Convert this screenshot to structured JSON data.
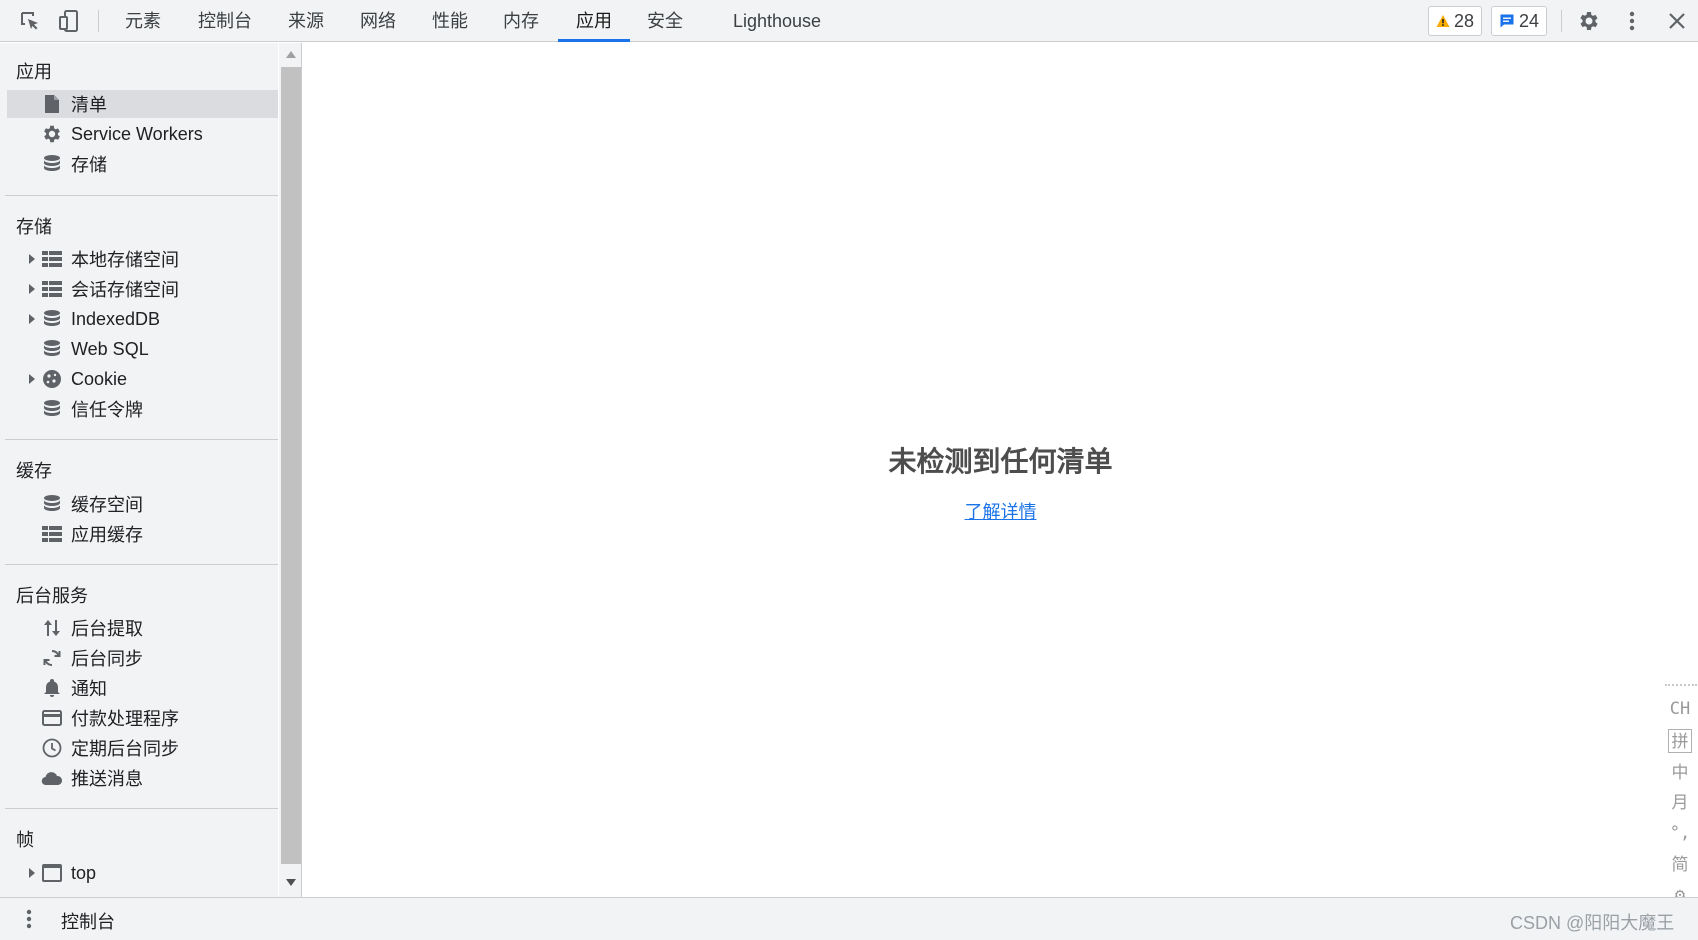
{
  "toolbar": {
    "tabs": [
      {
        "label": "元素"
      },
      {
        "label": "控制台"
      },
      {
        "label": "来源"
      },
      {
        "label": "网络"
      },
      {
        "label": "性能"
      },
      {
        "label": "内存"
      },
      {
        "label": "应用",
        "active": true
      },
      {
        "label": "安全"
      },
      {
        "label": "Lighthouse"
      }
    ],
    "warnings_count": "28",
    "messages_count": "24",
    "warning_color": "#f9ab00",
    "message_color": "#1a73e8"
  },
  "sidebar": {
    "sections": [
      {
        "title": "应用",
        "items": [
          {
            "label": "清单",
            "icon": "document-icon",
            "selected": true
          },
          {
            "label": "Service Workers",
            "icon": "gear-icon"
          },
          {
            "label": "存储",
            "icon": "database-icon"
          }
        ]
      },
      {
        "title": "存储",
        "items": [
          {
            "label": "本地存储空间",
            "icon": "table-icon",
            "expandable": true
          },
          {
            "label": "会话存储空间",
            "icon": "table-icon",
            "expandable": true
          },
          {
            "label": "IndexedDB",
            "icon": "database-icon",
            "expandable": true
          },
          {
            "label": "Web SQL",
            "icon": "database-icon"
          },
          {
            "label": "Cookie",
            "icon": "cookie-icon",
            "expandable": true
          },
          {
            "label": "信任令牌",
            "icon": "database-icon"
          }
        ]
      },
      {
        "title": "缓存",
        "items": [
          {
            "label": "缓存空间",
            "icon": "database-icon"
          },
          {
            "label": "应用缓存",
            "icon": "table-icon"
          }
        ]
      },
      {
        "title": "后台服务",
        "items": [
          {
            "label": "后台提取",
            "icon": "up-down-arrows-icon"
          },
          {
            "label": "后台同步",
            "icon": "sync-icon"
          },
          {
            "label": "通知",
            "icon": "bell-icon"
          },
          {
            "label": "付款处理程序",
            "icon": "credit-card-icon"
          },
          {
            "label": "定期后台同步",
            "icon": "clock-icon"
          },
          {
            "label": "推送消息",
            "icon": "cloud-icon"
          }
        ]
      },
      {
        "title": "帧",
        "items": [
          {
            "label": "top",
            "icon": "frame-icon",
            "expandable": true
          }
        ]
      }
    ]
  },
  "main": {
    "empty_title": "未检测到任何清单",
    "learn_more": "了解详情"
  },
  "ime": {
    "keys": [
      "CH",
      "拼",
      "中",
      "月",
      "°,",
      "简",
      "⚙"
    ]
  },
  "drawer": {
    "title": "控制台"
  },
  "watermark": "CSDN @阳阳大魔王"
}
